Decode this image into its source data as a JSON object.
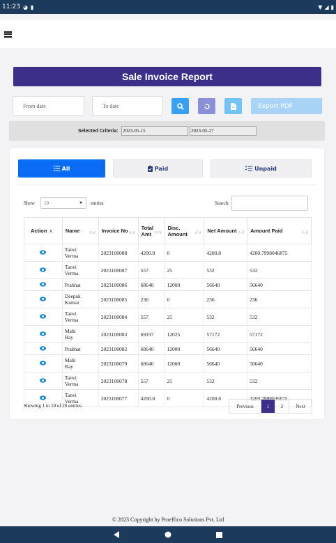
{
  "status_bar": {
    "time": "11:23"
  },
  "page": {
    "title": "Sale Invoice Report"
  },
  "filters": {
    "from_placeholder": "From date",
    "to_placeholder": "To date",
    "export_label": "Export PDF",
    "search_btn_color": "#3aa0f2",
    "reset_btn_color": "#8a8fd6",
    "doc_btn_color": "#75c2f5"
  },
  "criteria": {
    "label": "Selected Criteria:",
    "from": "2023-05-15",
    "to": "2023-05-27"
  },
  "tabs": [
    {
      "label": "All",
      "icon": "list-icon",
      "active": true
    },
    {
      "label": "Paid",
      "icon": "clipboard-check-icon",
      "active": false
    },
    {
      "label": "Unpaid",
      "icon": "checklist-icon",
      "active": false
    }
  ],
  "table_controls": {
    "show": "Show",
    "entries_value": "10",
    "entries": "entries",
    "search": "Search:"
  },
  "table": {
    "columns": [
      "Action",
      "Name",
      "Invoice No",
      "Total Amt",
      "Disc. Amount",
      "Net Amount",
      "Amount Paid"
    ],
    "rows": [
      [
        "Tanvi Verma",
        "2023100088",
        "4200.8",
        "0",
        "4200.8",
        "4200.7998046875"
      ],
      [
        "Tanvi Verma",
        "2023100087",
        "557",
        "25",
        "532",
        "532"
      ],
      [
        "Prabhat",
        "2023100086",
        "68640",
        "12000",
        "56640",
        "56640"
      ],
      [
        "Deepak Kumar",
        "2023100085",
        "236",
        "0",
        "236",
        "236"
      ],
      [
        "Tanvi Verma",
        "2023100084",
        "557",
        "25",
        "532",
        "532"
      ],
      [
        "Mahi Ray",
        "2023100083",
        "69197",
        "12025",
        "57172",
        "57172"
      ],
      [
        "Prabhat",
        "2023100082",
        "68640",
        "12000",
        "56640",
        "56640"
      ],
      [
        "Mahi Ray",
        "2023100079",
        "68640",
        "12000",
        "56640",
        "56640"
      ],
      [
        "Tanvi Verma",
        "2023100078",
        "557",
        "25",
        "532",
        "532"
      ],
      [
        "Tanvi Verma",
        "2023100077",
        "4200.8",
        "0",
        "4200.8",
        "4200.7998046875"
      ]
    ]
  },
  "footer": {
    "info": "Showing 1 to 10 of 20 entries",
    "prev": "Previous",
    "pages": [
      "1",
      "2"
    ],
    "current_page": "1",
    "next": "Next",
    "copyright": "© 2023 Copyright by Proeffico Solutions Pvt. Ltd"
  },
  "colors": {
    "brand": "#3c2f8a",
    "tab_active": "#0a6cf5",
    "eye": "#1e8ad6",
    "status_bar": "#1c3a5c"
  }
}
